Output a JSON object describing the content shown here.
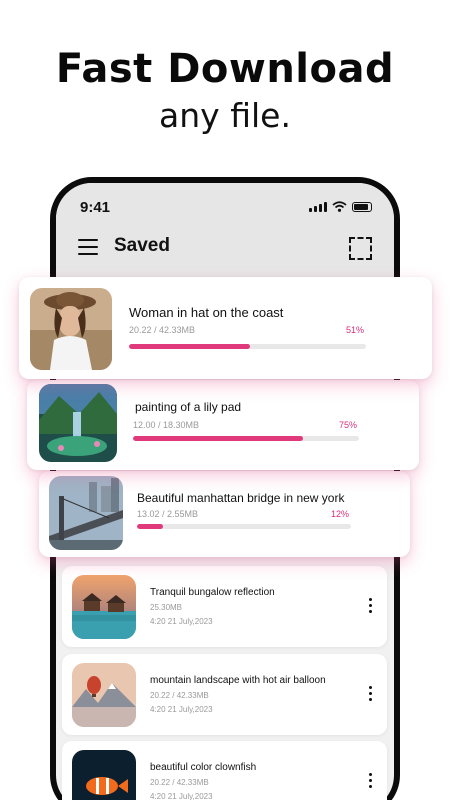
{
  "headline": {
    "line1": "Fast Download",
    "line2": "any file."
  },
  "status_bar": {
    "time": "9:41",
    "icons": [
      "signal-icon",
      "wifi-icon",
      "battery-icon"
    ]
  },
  "app_bar": {
    "title": "Saved",
    "menu_icon": "hamburger-menu-icon",
    "action_icon": "select-icon"
  },
  "downloads": [
    {
      "title": "Woman in hat on the coast",
      "size": "20.22 / 42.33MB",
      "percent_label": "51%",
      "progress": 0.51
    },
    {
      "title": "painting of a lily pad",
      "size": "12.00 / 18.30MB",
      "percent_label": "75%",
      "progress": 0.75
    },
    {
      "title": "Beautiful manhattan bridge in new york",
      "size": "13.02 / 2.55MB",
      "percent_label": "12%",
      "progress": 0.12
    }
  ],
  "saved_files": [
    {
      "title": "Tranquil bungalow reflection",
      "size": "25.30MB",
      "date": "4:20   21 July,2023"
    },
    {
      "title": " mountain landscape with hot air balloon",
      "size": "20.22 / 42.33MB",
      "date": "4:20   21 July,2023"
    },
    {
      "title": "beautiful color clownfish",
      "size": "20.22 / 42.33MB",
      "date": "4:20   21 July,2023"
    }
  ],
  "colors": {
    "accent": "#e03a7c",
    "percent": "#d8307c",
    "secondary_text": "#9a9a9a",
    "header_bg": "#e6e6e6"
  }
}
